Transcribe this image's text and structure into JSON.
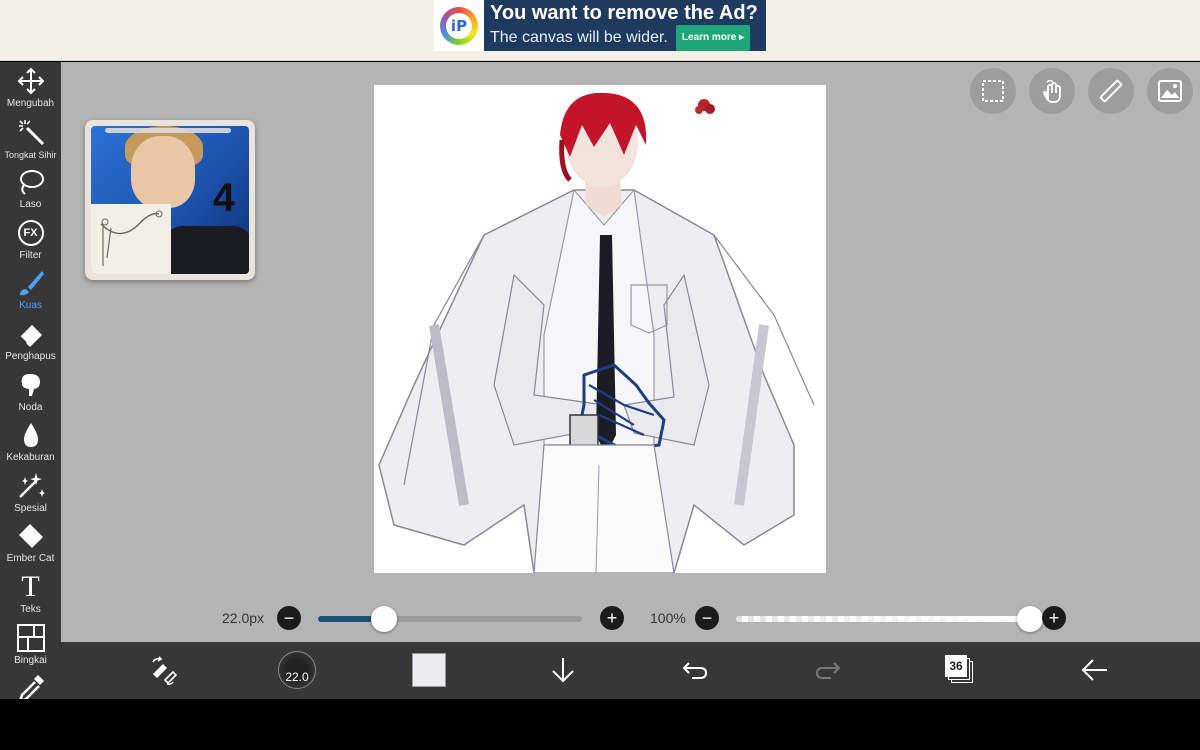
{
  "ad": {
    "title": "You want to remove the Ad?",
    "subtitle": "The canvas will be wider.",
    "learn_more": "Learn more ▸",
    "logo_letter": "iP"
  },
  "tools": [
    {
      "label": "Mengubah",
      "icon": "move-icon"
    },
    {
      "label": "Tongkat Sihir",
      "icon": "magic-wand-icon"
    },
    {
      "label": "Laso",
      "icon": "lasso-icon"
    },
    {
      "label": "Filter",
      "icon": "fx-icon",
      "glyph": "FX"
    },
    {
      "label": "Kuas",
      "icon": "brush-icon",
      "active": true
    },
    {
      "label": "Penghapus",
      "icon": "eraser-icon"
    },
    {
      "label": "Noda",
      "icon": "smudge-icon"
    },
    {
      "label": "Kekaburan",
      "icon": "blur-drop-icon"
    },
    {
      "label": "Spesial",
      "icon": "special-sparkle-icon"
    },
    {
      "label": "Ember Cat",
      "icon": "paint-bucket-icon"
    },
    {
      "label": "Teks",
      "icon": "text-icon",
      "glyph": "T"
    },
    {
      "label": "Bingkai",
      "icon": "frame-icon"
    },
    {
      "label": "",
      "icon": "eyedropper-icon"
    }
  ],
  "reference": {
    "number": "4"
  },
  "sliders": {
    "brush_size_label": "22.0px",
    "brush_size_fraction": 0.25,
    "opacity_label": "100%",
    "opacity_fraction": 1.0
  },
  "bottom": {
    "brush_size_value": "22.0",
    "layer_count": "36",
    "current_color": "#ececf0"
  },
  "colors": {
    "toolbar_bg": "#373737",
    "workspace_bg": "#b4b4b4",
    "active_tool": "#4aa3ff",
    "slider_fill": "#1f4f7a"
  }
}
